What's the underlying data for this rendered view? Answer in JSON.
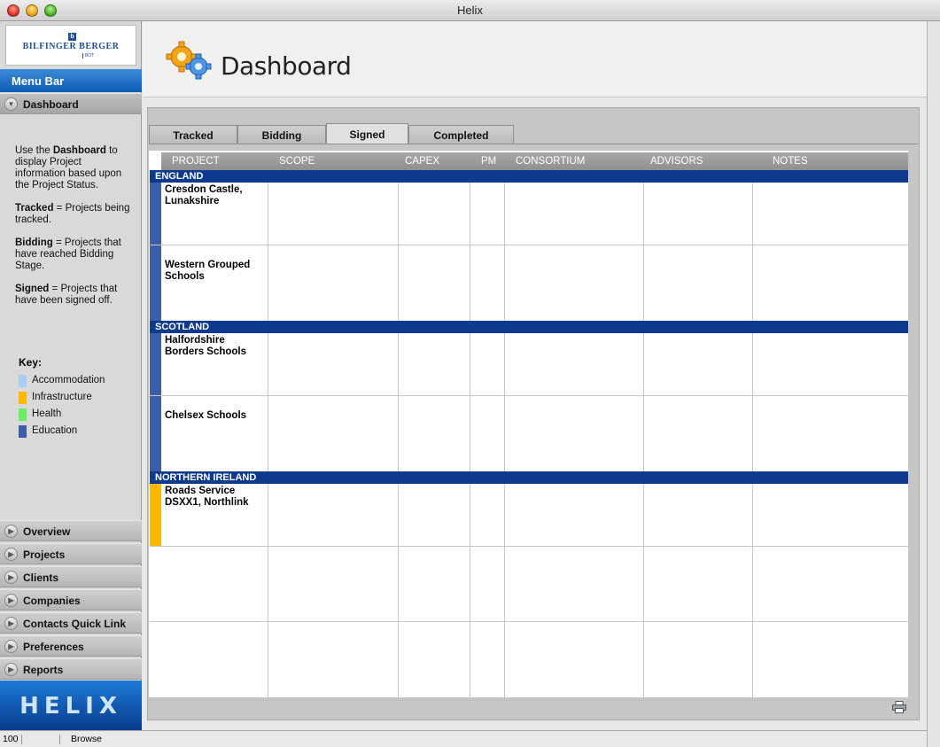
{
  "window": {
    "title": "Helix"
  },
  "logo": {
    "brand": "BILFINGER BERGER",
    "sub": "BOT"
  },
  "sidebar": {
    "menu_bar_label": "Menu Bar",
    "active_item": "Dashboard",
    "help": {
      "p1_pre": "Use the ",
      "p1_bold": "Dashboard",
      "p1_post": " to display Project information based upon the Project Status.",
      "p2_bold": "Tracked",
      "p2_post": " = Projects being tracked.",
      "p3_bold": "Bidding",
      "p3_post": " = Projects that have reached Bidding Stage.",
      "p4_bold": "Signed",
      "p4_post": " = Projects that have been signed off."
    },
    "key_title": "Key:",
    "key": [
      {
        "label": "Accommodation",
        "color": "#a7cdf2"
      },
      {
        "label": "Infrastructure",
        "color": "#ffb800"
      },
      {
        "label": "Health",
        "color": "#66ee66"
      },
      {
        "label": "Education",
        "color": "#3c5da8"
      }
    ],
    "nav": [
      "Overview",
      "Projects",
      "Clients",
      "Companies",
      "Contacts Quick Link",
      "Preferences",
      "Reports"
    ],
    "brand_footer": "HELIX"
  },
  "header": {
    "title": "Dashboard"
  },
  "tabs": [
    "Tracked",
    "Bidding",
    "Signed",
    "Completed"
  ],
  "active_tab": "Signed",
  "table": {
    "columns": [
      "PROJECT",
      "SCOPE",
      "CAPEX",
      "PM",
      "CONSORTIUM",
      "ADVISORS",
      "NOTES"
    ],
    "regions": [
      {
        "name": "ENGLAND",
        "projects": [
          {
            "name": "Cresdon Castle, Lunakshire",
            "color": "#3c5da8"
          },
          {
            "name": "Western Grouped Schools",
            "color": "#3c5da8"
          }
        ]
      },
      {
        "name": "SCOTLAND",
        "projects": [
          {
            "name": "Halfordshire Borders Schools",
            "color": "#3c5da8"
          },
          {
            "name": "Chelsex Schools",
            "color": "#3c5da8"
          }
        ]
      },
      {
        "name": "NORTHERN IRELAND",
        "projects": [
          {
            "name": "Roads Service DSXX1, Northlink",
            "color": "#ffb800"
          }
        ]
      }
    ]
  },
  "statusbar": {
    "zoom": "100",
    "mode": "Browse"
  }
}
